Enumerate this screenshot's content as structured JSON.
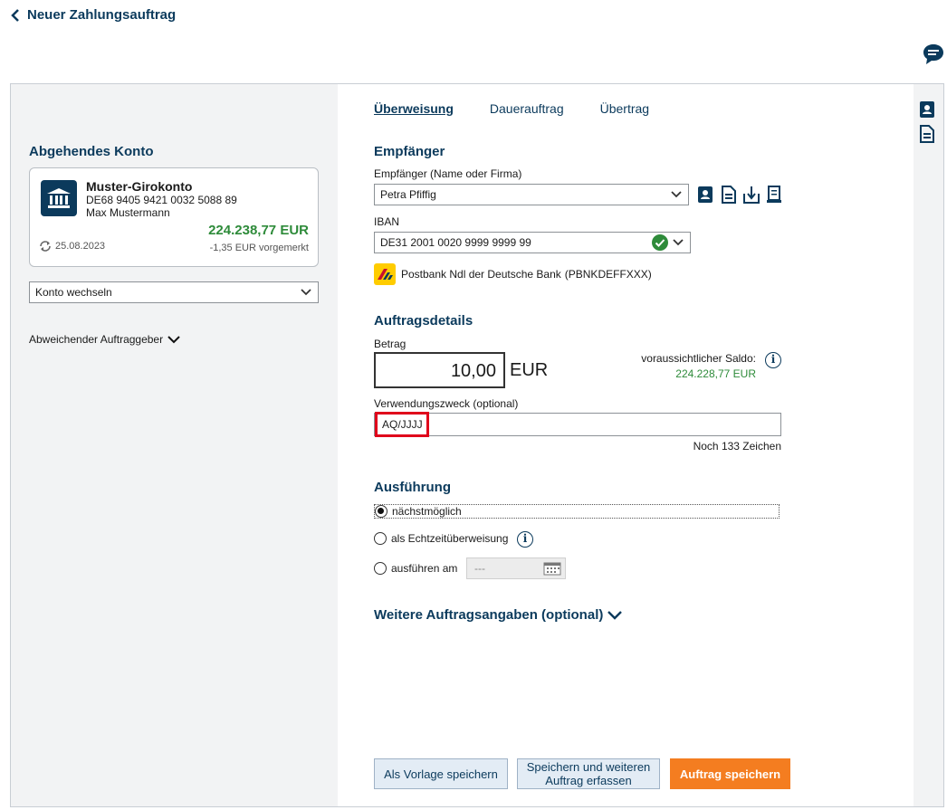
{
  "header": {
    "title": "Neuer Zahlungsauftrag"
  },
  "tabs": [
    {
      "label": "Überweisung",
      "active": true
    },
    {
      "label": "Dauerauftrag",
      "active": false
    },
    {
      "label": "Übertrag",
      "active": false
    }
  ],
  "left": {
    "title": "Abgehendes Konto",
    "account": {
      "name": "Muster-Girokonto",
      "iban": "DE68 9405 9421 0032 5088 89",
      "owner": "Max Mustermann",
      "balance": "224.238,77 EUR",
      "date": "25.08.2023",
      "pending": "-1,35 EUR vorgemerkt"
    },
    "switch_label": "Konto wechseln",
    "other_principal": "Abweichender Auftraggeber"
  },
  "recipient": {
    "title": "Empfänger",
    "name_label": "Empfänger (Name oder Firma)",
    "name_value": "Petra Pfiffig",
    "iban_label": "IBAN",
    "iban_value": "DE31 2001 0020 9999 9999 99",
    "bank": "Postbank Ndl der Deutsche Bank",
    "bic": "(PBNKDEFFXXX)"
  },
  "details": {
    "title": "Auftragsdetails",
    "amount_label": "Betrag",
    "amount_value": "10,00",
    "currency": "EUR",
    "saldo_label": "voraussichtlicher Saldo:",
    "saldo_value": "224.228,77 EUR",
    "purpose_label": "Verwendungszweck (optional)",
    "purpose_value": "AQ/JJJJ",
    "remaining": "Noch 133 Zeichen"
  },
  "execution": {
    "title": "Ausführung",
    "opt1": "nächstmöglich",
    "opt2": "als Echtzeitüberweisung",
    "opt3": "ausführen am",
    "date_placeholder": "---"
  },
  "more_label": "Weitere Auftragsangaben (optional)",
  "buttons": {
    "template": "Als Vorlage speichern",
    "save_more": "Speichern und weiteren Auftrag erfassen",
    "save": "Auftrag speichern"
  },
  "colors": {
    "brand": "#0b3a5c",
    "positive": "#2e8b3a",
    "accent": "#f47d20",
    "highlight": "#e0001b"
  }
}
